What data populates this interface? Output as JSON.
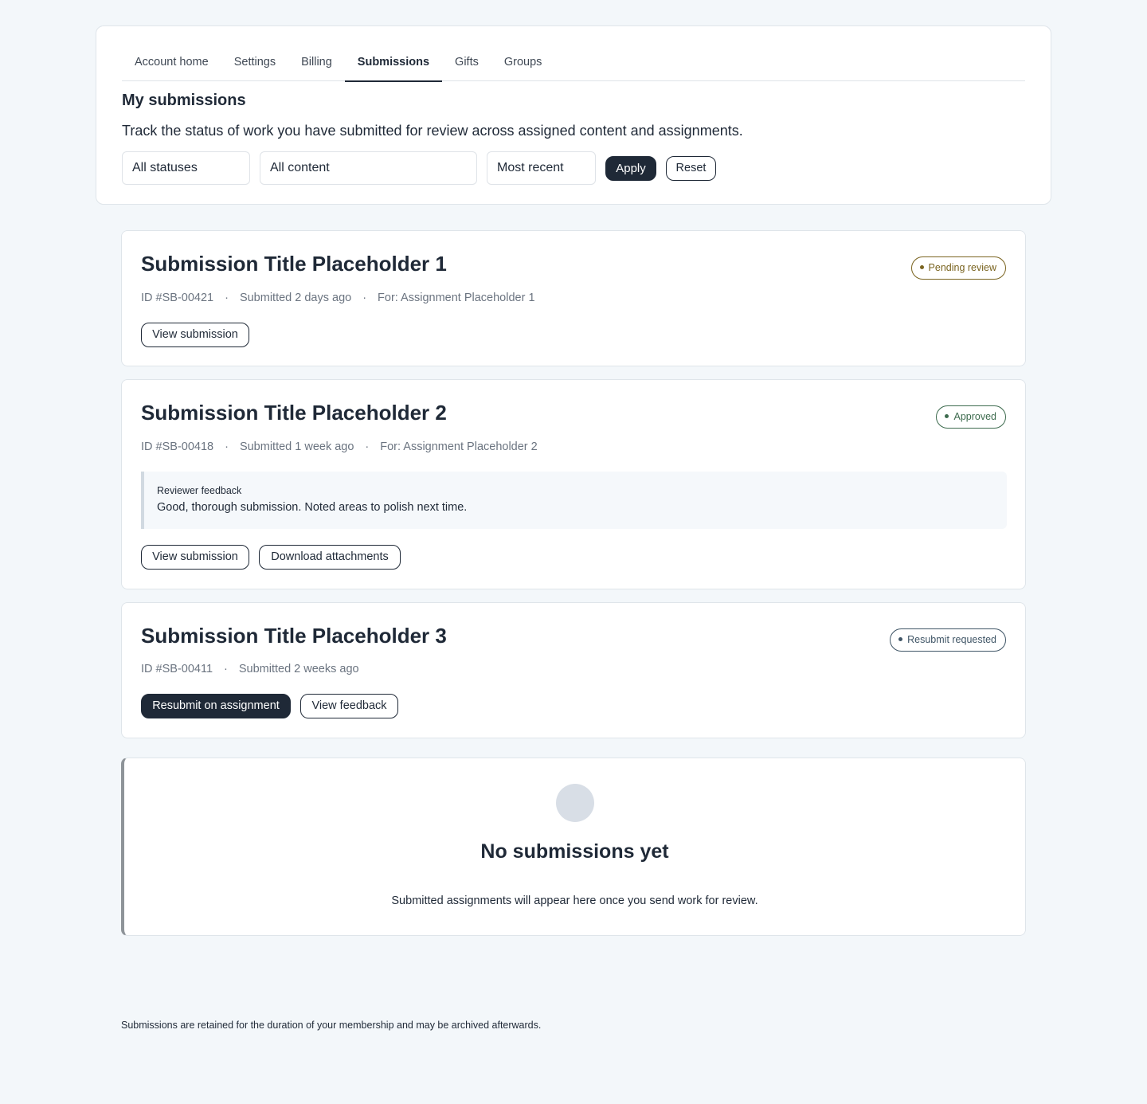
{
  "tabs": [
    {
      "label": "Account home"
    },
    {
      "label": "Settings"
    },
    {
      "label": "Billing"
    },
    {
      "label": "Submissions",
      "active": true
    },
    {
      "label": "Gifts"
    },
    {
      "label": "Groups"
    }
  ],
  "header": {
    "title": "My submissions",
    "description": "Track the status of work you have submitted for review across assigned content and assignments."
  },
  "filters": {
    "status_value": "All statuses",
    "content_value": "All content",
    "sort_value": "Most recent",
    "apply_label": "Apply",
    "reset_label": "Reset"
  },
  "submissions": [
    {
      "title": "Submission Title Placeholder 1",
      "id": "ID #SB-00421",
      "submitted": "Submitted 2 days ago",
      "for": "For: Assignment Placeholder 1",
      "status": "Pending review",
      "status_color": "#7a6420",
      "actions": [
        "View submission"
      ]
    },
    {
      "title": "Submission Title Placeholder 2",
      "id": "ID #SB-00418",
      "submitted": "Submitted 1 week ago",
      "for": "For: Assignment Placeholder 2",
      "status": "Approved",
      "status_color": "#3d6b4e",
      "feedback_label": "Reviewer feedback",
      "feedback_text": "Good, thorough submission. Noted areas to polish next time.",
      "actions": [
        "View submission",
        "Download attachments"
      ]
    },
    {
      "title": "Submission Title Placeholder 3",
      "id": "ID #SB-00411",
      "submitted": "Submitted 2 weeks ago",
      "status": "Resubmit requested",
      "status_color": "#3f5566",
      "actions": [
        "Resubmit on assignment",
        "View feedback"
      ]
    }
  ],
  "empty_state": {
    "title": "No submissions yet",
    "text": "Submitted assignments will appear here once you send work for review."
  },
  "footer": {
    "note": "Submissions are retained for the duration of your membership and may be archived afterwards."
  }
}
